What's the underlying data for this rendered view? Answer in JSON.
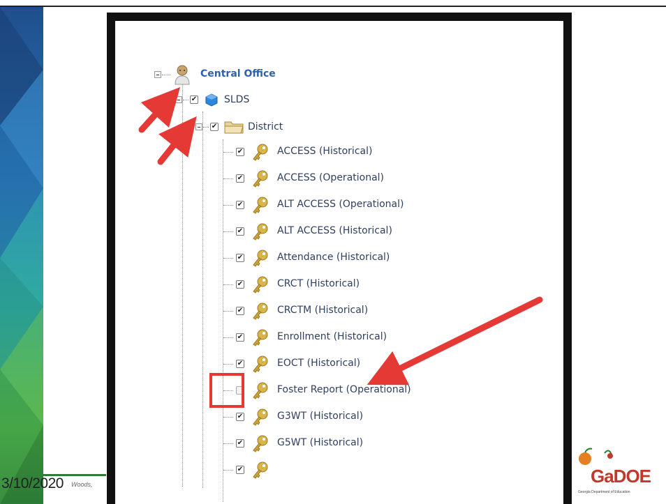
{
  "slide": {
    "date": "3/10/2020",
    "footer_fragment": "Woods,"
  },
  "tree": {
    "root": {
      "label": "Central Office",
      "icon": "person-icon"
    },
    "level1": {
      "label": "SLDS",
      "icon": "cube-icon",
      "checked": true
    },
    "level2": {
      "label": "District",
      "icon": "folder-icon",
      "checked": true
    },
    "items": [
      {
        "label": "ACCESS (Historical)",
        "checked": true
      },
      {
        "label": "ACCESS (Operational)",
        "checked": true
      },
      {
        "label": "ALT ACCESS (Operational)",
        "checked": true
      },
      {
        "label": "ALT ACCESS (Historical)",
        "checked": true
      },
      {
        "label": "Attendance (Historical)",
        "checked": true
      },
      {
        "label": "CRCT (Historical)",
        "checked": true
      },
      {
        "label": "CRCTM (Historical)",
        "checked": true
      },
      {
        "label": "Enrollment (Historical)",
        "checked": true
      },
      {
        "label": "EOCT (Historical)",
        "checked": true
      },
      {
        "label": "Foster Report (Operational)",
        "checked": false
      },
      {
        "label": "G3WT (Historical)",
        "checked": true
      },
      {
        "label": "G5WT (Historical)",
        "checked": true
      },
      {
        "label": "",
        "checked": true
      }
    ],
    "item_icon": "key-icon"
  },
  "annotations": {
    "arrow_color": "#e53935",
    "highlight_color": "#e53935"
  },
  "logo": {
    "word": "GaDOE",
    "tagline": "Georgia Department of Education"
  }
}
